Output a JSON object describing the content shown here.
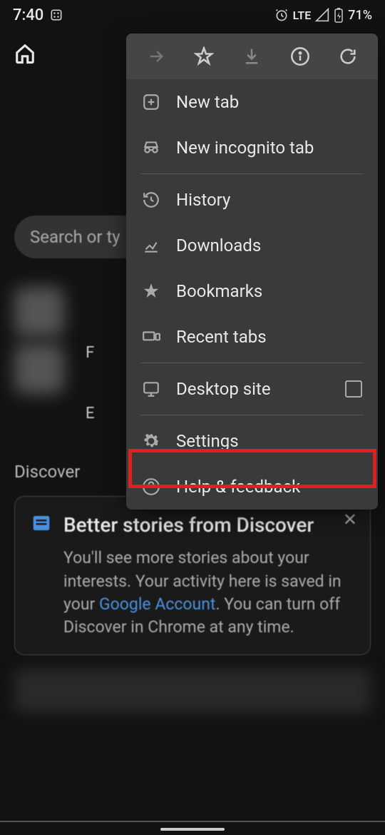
{
  "status": {
    "time": "7:40",
    "lte": "LTE",
    "battery": "71%"
  },
  "search": {
    "placeholder": "Search or ty"
  },
  "letters": [
    "F",
    "E"
  ],
  "discover": "Discover",
  "card": {
    "title": "Better stories from Discover",
    "text_before": "You'll see more stories about your interests. Your activity here is saved in your ",
    "link": "Google Account",
    "text_after": ". You can turn off Discover in Chrome at any time."
  },
  "menu": {
    "new_tab": "New tab",
    "new_incognito": "New incognito tab",
    "history": "History",
    "downloads": "Downloads",
    "bookmarks": "Bookmarks",
    "recent_tabs": "Recent tabs",
    "desktop_site": "Desktop site",
    "settings": "Settings",
    "help": "Help & feedback"
  }
}
